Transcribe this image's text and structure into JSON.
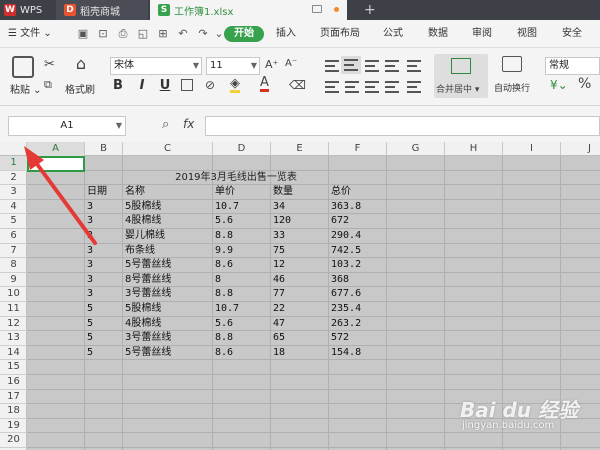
{
  "titlebar": {
    "tabs": [
      {
        "icon": "W",
        "label": "WPS"
      },
      {
        "icon": "D",
        "label": "稻壳商城"
      },
      {
        "icon": "S",
        "label": "工作簿1.xlsx"
      }
    ],
    "add_tab": "+"
  },
  "menubar": {
    "file_label": "文件",
    "items": [
      "开始",
      "插入",
      "页面布局",
      "公式",
      "数据",
      "审阅",
      "视图",
      "安全"
    ]
  },
  "toolbar": {
    "paste_label": "粘贴",
    "format_painter_label": "格式刷",
    "font_name": "宋体",
    "font_size": "11",
    "merge_label": "合并居中",
    "wrap_label": "自动换行",
    "number_format": "常规",
    "percent": "%"
  },
  "formulabar": {
    "cell_ref": "A1",
    "fx_label": "fx",
    "formula": ""
  },
  "grid": {
    "columns": [
      "A",
      "B",
      "C",
      "D",
      "E",
      "F",
      "G",
      "H",
      "I",
      "J"
    ],
    "rows": [
      "1",
      "2",
      "3",
      "4",
      "5",
      "6",
      "7",
      "8",
      "9",
      "10",
      "11",
      "12",
      "13",
      "14",
      "15",
      "16",
      "17",
      "18",
      "19",
      "20"
    ],
    "title": "2019年3月毛线出售一览表",
    "headers": [
      "日期",
      "名称",
      "单价",
      "数量",
      "总价"
    ],
    "data": [
      [
        "3",
        "5股棉线",
        "10.7",
        "34",
        "363.8"
      ],
      [
        "3",
        "4股棉线",
        "5.6",
        "120",
        "672"
      ],
      [
        "3",
        "婴儿棉线",
        "8.8",
        "33",
        "290.4"
      ],
      [
        "3",
        "布条线",
        "9.9",
        "75",
        "742.5"
      ],
      [
        "3",
        "5号蕾丝线",
        "8.6",
        "12",
        "103.2"
      ],
      [
        "3",
        "8号蕾丝线",
        "8",
        "46",
        "368"
      ],
      [
        "3",
        "3号蕾丝线",
        "8.8",
        "77",
        "677.6"
      ],
      [
        "5",
        "5股棉线",
        "10.7",
        "22",
        "235.4"
      ],
      [
        "5",
        "4股棉线",
        "5.6",
        "47",
        "263.2"
      ],
      [
        "5",
        "3号蕾丝线",
        "8.8",
        "65",
        "572"
      ],
      [
        "5",
        "5号蕾丝线",
        "8.6",
        "18",
        "154.8"
      ]
    ]
  },
  "watermark": {
    "brand": "Bai du 经验",
    "url": "jingyan.baidu.com"
  },
  "colors": {
    "accent": "#37a14d",
    "titlebar": "#3d4047",
    "arrow": "#e53935"
  }
}
